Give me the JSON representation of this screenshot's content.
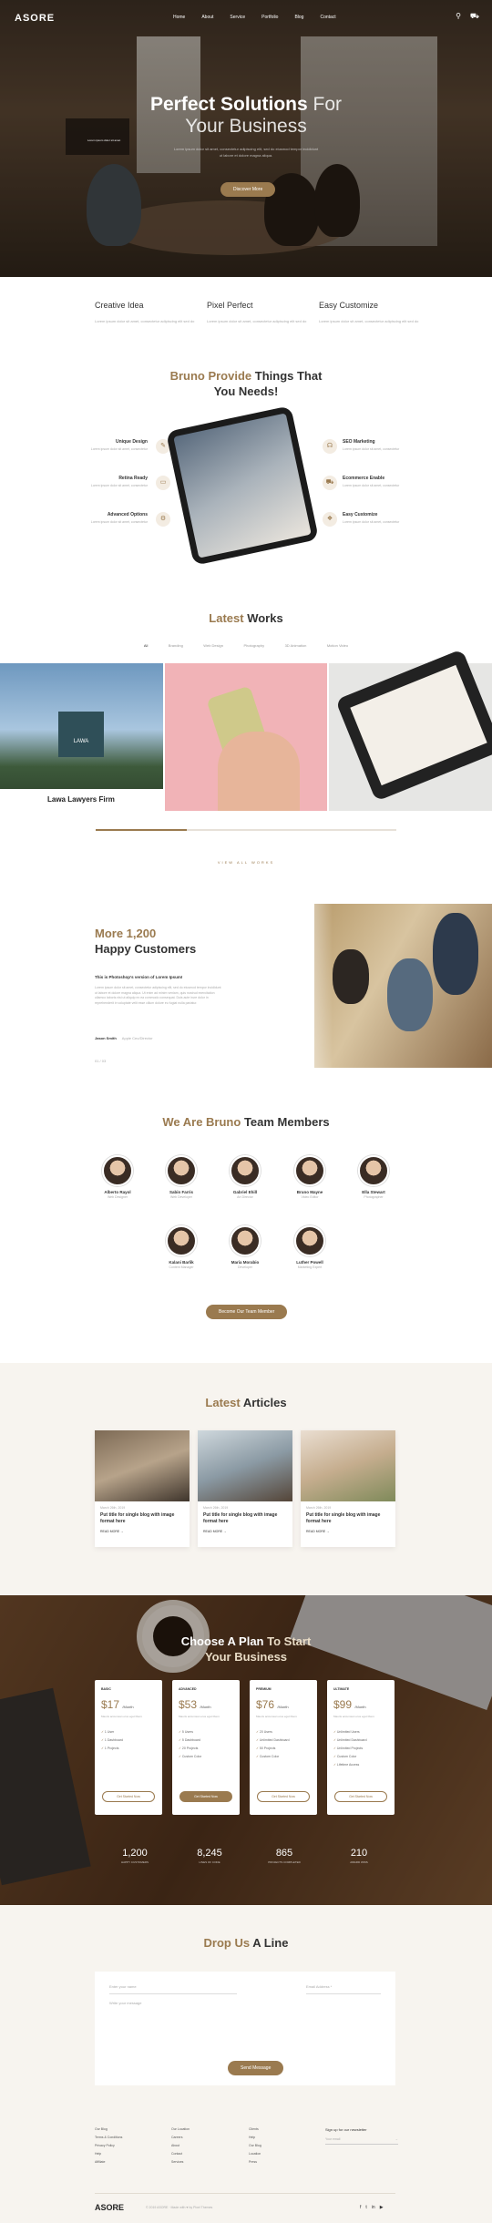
{
  "nav": {
    "logo": "ASORE",
    "links": [
      "Home",
      "About",
      "Service",
      "Portfolio",
      "Blog",
      "Contact"
    ]
  },
  "hero": {
    "title_bold": "Perfect Solutions",
    "title_light": "For",
    "title_line2": "Your Business",
    "subtitle": "Lorem ipsum dolor sit amet, consectetur adipiscing elit, sed do eiusmod tempor incididunt ut labore et dolore magna aliqua.",
    "button": "Discover More",
    "caption": "Lorem ipsum dolor sit amet"
  },
  "features": [
    {
      "title": "Creative Idea",
      "text": "Lorem ipsum dolor sit amet, consectetur adipiscing elit sed do"
    },
    {
      "title": "Pixel Perfect",
      "text": "Lorem ipsum dolor sit amet, consectetur adipiscing elit sed do"
    },
    {
      "title": "Easy Customize",
      "text": "Lorem ipsum dolor sit amet, consectetur adipiscing elit sed do"
    }
  ],
  "provide": {
    "title_bold": "Bruno Provide",
    "title_rest": "Things That",
    "title_line2": "You Needs!",
    "items_left": [
      {
        "title": "Unique Design",
        "text": "Lorem ipsum dolor sit amet, consectetur"
      },
      {
        "title": "Retina Ready",
        "text": "Lorem ipsum dolor sit amet, consectetur"
      },
      {
        "title": "Advanced Options",
        "text": "Lorem ipsum dolor sit amet, consectetur"
      }
    ],
    "items_right": [
      {
        "title": "SEO Marketing",
        "text": "Lorem ipsum dolor sit amet, consectetur"
      },
      {
        "title": "Ecommerce Enable",
        "text": "Lorem ipsum dolor sit amet, consectetur"
      },
      {
        "title": "Easy Customize",
        "text": "Lorem ipsum dolor sit amet, consectetur"
      }
    ]
  },
  "works": {
    "title_bold": "Latest",
    "title_rest": "Works",
    "filters": [
      "All",
      "Branding",
      "Web Design",
      "Photography",
      "3D Animation",
      "Motion Video"
    ],
    "first_label": "Lawa Lawyers Firm",
    "logo_text": "LAWA",
    "view_all": "VIEW ALL WORKS"
  },
  "customers": {
    "title_bold": "More 1,200",
    "title_line2": "Happy Customers",
    "subtitle": "This is Photoshop's version of Lorem Ipsum!",
    "text": "Lorem ipsum dolor sit amet, consectetur adipiscing elit, sed do eiusmod tempor incididunt ut labore et dolore magna aliqua. Ut enim ad minim veniam, quis nostrud exercitation ullamco laboris nisi ut aliquip ex ea commodo consequat. Duis aute irure dolor in reprehenderit in voluptate velit esse cillum dolore eu fugiat nulla pariatur.",
    "author": "Jason Smith",
    "author_role": "Apple Ceo/Director",
    "pager": "01 / 03"
  },
  "team": {
    "title_bold": "We Are Bruno",
    "title_rest": "Team Members",
    "members": [
      {
        "name": "Alberto Rayol",
        "role": "Web Designer"
      },
      {
        "name": "Sabin Farris",
        "role": "Web Developer"
      },
      {
        "name": "Gabriel Ehill",
        "role": "Art Director"
      },
      {
        "name": "Bruno Mayne",
        "role": "Video Editor"
      },
      {
        "name": "Ella Stewart",
        "role": "Photographer"
      },
      {
        "name": "Kalani Barlik",
        "role": "Content Manager"
      },
      {
        "name": "Maria Morabio",
        "role": "Developer"
      },
      {
        "name": "Luther Powell",
        "role": "Marketing Expert"
      }
    ],
    "button": "Become Our Team Member"
  },
  "articles": {
    "title_bold": "Latest",
    "title_rest": "Articles",
    "items": [
      {
        "date": "March 26th, 2019",
        "title": "Put title for single blog with image format here",
        "more": "READ MORE →"
      },
      {
        "date": "March 26th, 2019",
        "title": "Put title for single blog with image format here",
        "more": "READ MORE →"
      },
      {
        "date": "March 26th, 2019",
        "title": "Put title for single blog with image format here",
        "more": "READ MORE →"
      }
    ]
  },
  "pricing": {
    "title_bold": "Choose A Plan",
    "title_rest": "To Start",
    "title_line2": "Your Business",
    "plans": [
      {
        "name": "BASIC",
        "price": "$17",
        "unit": "/Month",
        "desc": "Mauris accumsan eros eget libero",
        "features": [
          "1 User",
          "1 Dashboard",
          "1 Projects"
        ],
        "button": "Get Started Now",
        "filled": false
      },
      {
        "name": "ADVANCED",
        "price": "$53",
        "unit": "/Month",
        "desc": "Mauris accumsan eros eget libero",
        "features": [
          "5 Users",
          "5 Dashboard",
          "20 Projects",
          "Custom Color"
        ],
        "button": "Get Started Now",
        "filled": true
      },
      {
        "name": "PREMIUM",
        "price": "$76",
        "unit": "/Month",
        "desc": "Mauris accumsan eros eget libero",
        "features": [
          "20 Users",
          "Unlimited Dashboard",
          "50 Projects",
          "Custom Color"
        ],
        "button": "Get Started Now",
        "filled": false
      },
      {
        "name": "ULTIMATE",
        "price": "$99",
        "unit": "/Month",
        "desc": "Mauris accumsan eros eget libero",
        "features": [
          "Unlimited Users",
          "Unlimited Dashboard",
          "Unlimited Projects",
          "Custom Color",
          "Lifetime Access"
        ],
        "button": "Get Started Now",
        "filled": false
      }
    ],
    "stats": [
      {
        "value": "1,200",
        "label": "HAPPY CUSTOMERS"
      },
      {
        "value": "8,245",
        "label": "LINES OF CODE"
      },
      {
        "value": "865",
        "label": "PROJECTS COMPLETED"
      },
      {
        "value": "210",
        "label": "AWARD WINS"
      }
    ]
  },
  "contact": {
    "title_bold": "Drop Us",
    "title_rest": "A Line",
    "name_placeholder": "Enter your name",
    "email_placeholder": "Email Address *",
    "message_placeholder": "Write your message",
    "button": "Send Message"
  },
  "footer": {
    "col1": [
      "Our Blog",
      "Terms & Conditions",
      "Privacy Policy",
      "Help",
      "Affiliate"
    ],
    "col2": [
      "Our Location",
      "Careers",
      "About",
      "Contact",
      "Services"
    ],
    "col3": [
      "Clients",
      "Help",
      "Our Blog",
      "Location",
      "Press"
    ],
    "subscribe_title": "Sign up for our newsletter",
    "subscribe_placeholder": "Your email",
    "logo": "ASORE",
    "copyright": "© 2019 ASORE · Made with ♥ by Pixel Themes",
    "social": [
      "f",
      "t",
      "in",
      "▶"
    ]
  },
  "colors": {
    "accent": "#9a7a4f",
    "dark": "#333333",
    "cream": "#f7f4ef"
  }
}
